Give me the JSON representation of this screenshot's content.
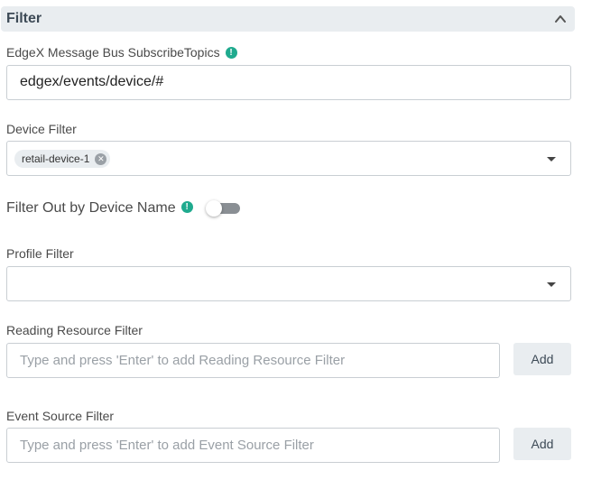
{
  "panel": {
    "title": "Filter"
  },
  "subscribe_topics": {
    "label": "EdgeX Message Bus SubscribeTopics",
    "value": "edgex/events/device/#"
  },
  "device_filter": {
    "label": "Device Filter",
    "chips": [
      "retail-device-1"
    ]
  },
  "filter_out_by_device_name": {
    "label": "Filter Out by Device Name",
    "enabled": false
  },
  "profile_filter": {
    "label": "Profile Filter",
    "value": ""
  },
  "reading_resource_filter": {
    "label": "Reading Resource Filter",
    "placeholder": "Type and press 'Enter' to add Reading Resource Filter",
    "add_label": "Add"
  },
  "event_source_filter": {
    "label": "Event Source Filter",
    "placeholder": "Type and press 'Enter' to add Event Source Filter",
    "add_label": "Add"
  },
  "colors": {
    "header_bg": "#e9edf0",
    "info_icon": "#1faa8e",
    "border": "#c9ced3",
    "toggle_track": "#8a8f94"
  },
  "icons": {
    "collapse": "chevron-up-icon",
    "info": "info-icon",
    "dropdown": "caret-down-icon",
    "chip_remove": "close-circle-icon"
  }
}
